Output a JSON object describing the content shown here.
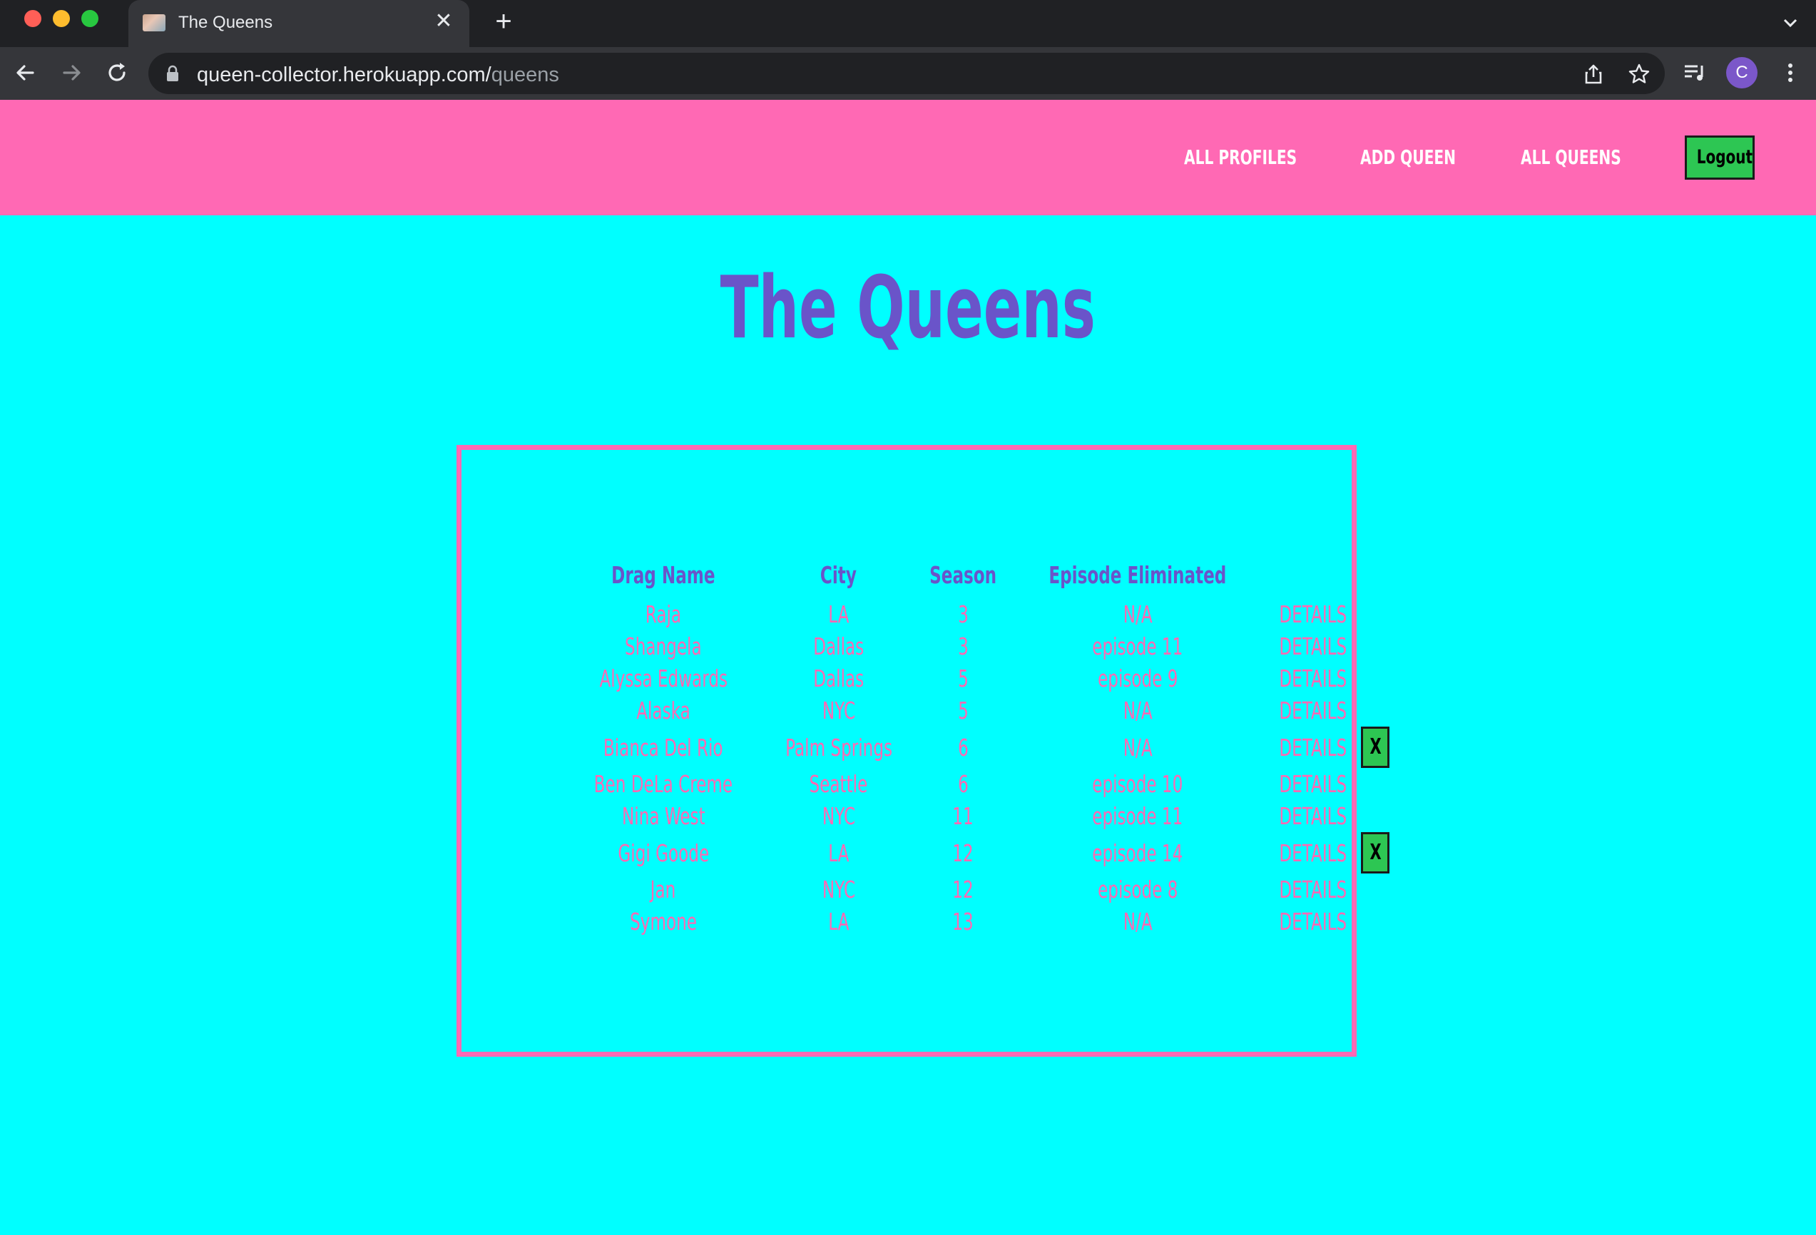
{
  "browser": {
    "tab_title": "The Queens",
    "tab_close_icon": "close-icon",
    "new_tab_label": "+",
    "url_host": "queen-collector.herokuapp.com/",
    "url_path": "queens",
    "profile_initial": "C"
  },
  "navbar": {
    "links": [
      "ALL PROFILES",
      "ADD QUEEN",
      "ALL QUEENS"
    ],
    "logout_label": "Logout",
    "background": "#ff69b4",
    "logout_color": "#2dc653"
  },
  "page": {
    "title": "The Queens",
    "background": "#00ffff",
    "title_color": "#6a54c9"
  },
  "table": {
    "headers": [
      "Drag Name",
      "City",
      "Season",
      "Episode Eliminated"
    ],
    "details_label": "DETAILS",
    "delete_label": "X",
    "rows": [
      {
        "name": "Raja",
        "city": "LA",
        "season": "3",
        "episode": "N/A",
        "deletable": false
      },
      {
        "name": "Shangela",
        "city": "Dallas",
        "season": "3",
        "episode": "episode 11",
        "deletable": false
      },
      {
        "name": "Alyssa Edwards",
        "city": "Dallas",
        "season": "5",
        "episode": "episode 9",
        "deletable": false
      },
      {
        "name": "Alaska",
        "city": "NYC",
        "season": "5",
        "episode": "N/A",
        "deletable": false
      },
      {
        "name": "Bianca Del Rio",
        "city": "Palm Springs",
        "season": "6",
        "episode": "N/A",
        "deletable": true
      },
      {
        "name": "Ben DeLa Creme",
        "city": "Seattle",
        "season": "6",
        "episode": "episode 10",
        "deletable": false
      },
      {
        "name": "Nina West",
        "city": "NYC",
        "season": "11",
        "episode": "episode 11",
        "deletable": false
      },
      {
        "name": "Gigi Goode",
        "city": "LA",
        "season": "12",
        "episode": "episode 14",
        "deletable": true
      },
      {
        "name": "Jan",
        "city": "NYC",
        "season": "12",
        "episode": "episode 8",
        "deletable": false
      },
      {
        "name": "Symone",
        "city": "LA",
        "season": "13",
        "episode": "N/A",
        "deletable": false
      }
    ]
  }
}
